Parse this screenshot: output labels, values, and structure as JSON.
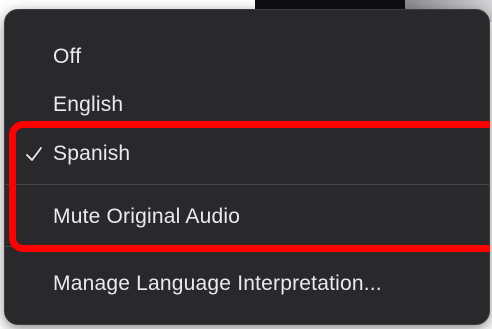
{
  "menu": {
    "items": [
      {
        "label": "Off",
        "checked": false
      },
      {
        "label": "English",
        "checked": false
      },
      {
        "label": "Spanish",
        "checked": true
      },
      {
        "label": "Mute Original Audio",
        "checked": false
      },
      {
        "label": "Manage Language Interpretation...",
        "checked": false
      }
    ]
  },
  "icons": {
    "check": "checkmark-icon"
  },
  "colors": {
    "menu_background": "#29292c",
    "menu_text": "#eaeaec",
    "separator": "#46464a",
    "highlight_box": "#fe0000"
  }
}
